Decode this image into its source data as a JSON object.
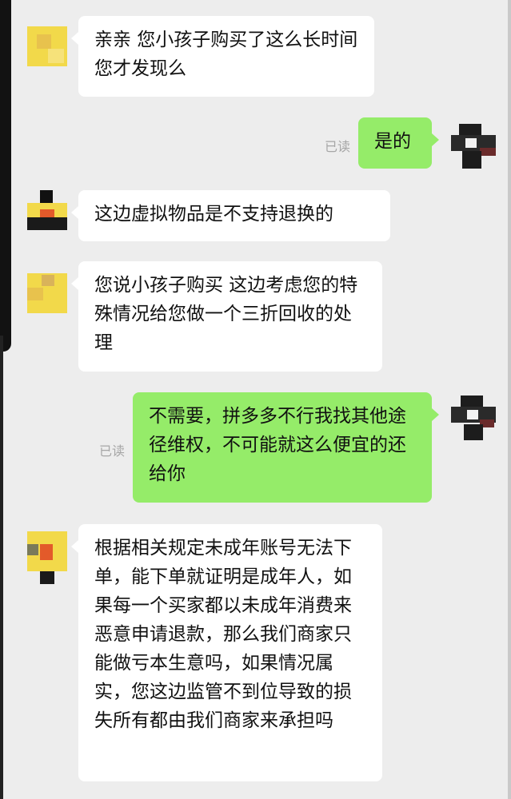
{
  "chat": {
    "read_label": "已读",
    "messages": [
      {
        "side": "in",
        "text": "亲亲  您小孩子购买了这么长时间您才发现么"
      },
      {
        "side": "out",
        "text": "是的",
        "status": "已读"
      },
      {
        "side": "in",
        "text": "这边虚拟物品是不支持退换的"
      },
      {
        "side": "in",
        "text": "您说小孩子购买  这边考虑您的特殊情况给您做一个三折回收的处理"
      },
      {
        "side": "out",
        "text": "不需要，拼多多不行我找其他途径维权，不可能就这么便宜的还给你",
        "status": "已读"
      },
      {
        "side": "in",
        "text": "根据相关规定未成年账号无法下单，能下单就证明是成年人，如果每一个买家都以未成年消费来恶意申请退款，那么我们商家只能做亏本生意吗，如果情况属实，您这边监管不到位导致的损失所有都由我们商家来承担吗"
      }
    ]
  },
  "colors": {
    "background": "#ededed",
    "incoming_bubble": "#ffffff",
    "outgoing_bubble": "#95ec69",
    "read_text": "#a6a6a6"
  }
}
